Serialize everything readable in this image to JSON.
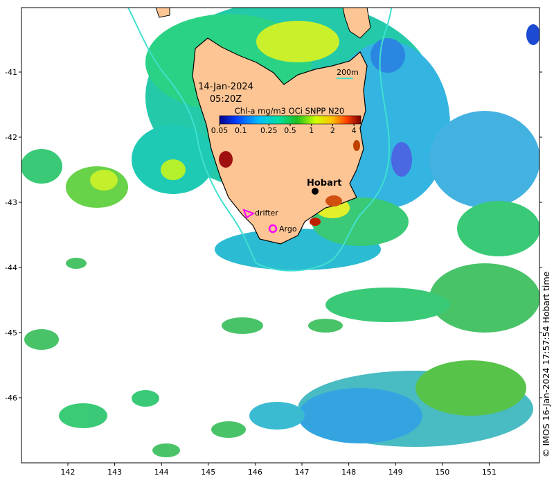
{
  "map": {
    "date_label": "14-Jan-2024",
    "time_label": "05:20Z",
    "colorbar_title": "Chl-a mg/m3 OCi SNPP N20",
    "colorbar_ticks": [
      "0.05",
      "0.1",
      "0.25",
      "0.5",
      "1",
      "2",
      "4"
    ],
    "colorbar_tick_values": [
      0.05,
      0.1,
      0.25,
      0.5,
      1,
      2,
      4
    ],
    "colorbar_range": [
      0.05,
      5
    ],
    "contour_label": "200m",
    "city_label": "Hobart",
    "drifter_label": "drifter",
    "argo_label": "Argo",
    "credit": "© IMOS 16-Jan-2024 17:57:54 Hobart time",
    "lon_ticks": [
      "142",
      "143",
      "144",
      "145",
      "146",
      "147",
      "148",
      "149",
      "150",
      "151"
    ],
    "lat_ticks": [
      "-41",
      "-42",
      "-43",
      "-44",
      "-45",
      "-46"
    ],
    "colors": {
      "land": "#fdc594",
      "contour": "#40e0d0",
      "drifter": "#ff00ff",
      "argo": "#ff00ff"
    }
  }
}
